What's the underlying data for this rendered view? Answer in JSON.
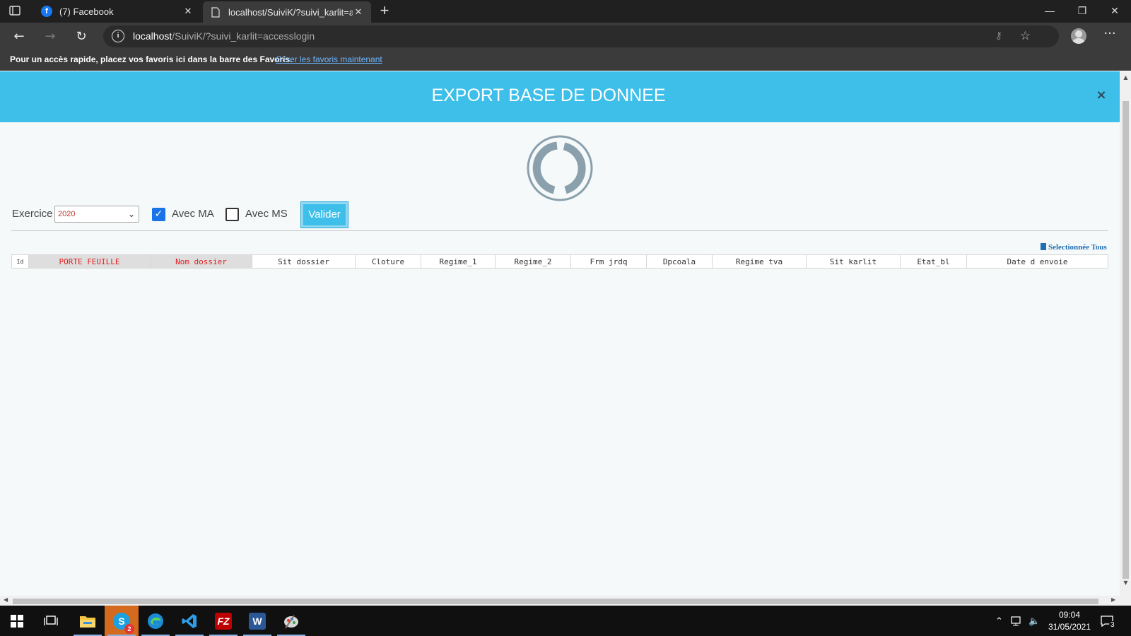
{
  "browser": {
    "tabs": [
      {
        "title": "(7) Facebook",
        "favicon": "facebook-icon",
        "active": false
      },
      {
        "title": "localhost/SuiviK/?suivi_karlit=acc",
        "favicon": "page-icon",
        "active": true
      }
    ],
    "url_host": "localhost",
    "url_rest": "/SuiviK/?suivi_karlit=accesslogin",
    "favorites_message": "Pour un accès rapide, placez vos favoris ici dans la barre des Favoris.",
    "favorites_link": "Gérer les favoris maintenant"
  },
  "modal": {
    "title": "EXPORT BASE DE DONNEE",
    "close_label": "×"
  },
  "form": {
    "exercice_label": "Exercice",
    "exercice_value": "2020",
    "avec_ma_label": "Avec MA",
    "avec_ma_checked": true,
    "avec_ms_label": "Avec MS",
    "avec_ms_checked": false,
    "valider_label": "Valider"
  },
  "table": {
    "select_all_label": "Selectionnée Tous",
    "columns": [
      {
        "label": "Id",
        "highlight": false
      },
      {
        "label": "PORTE FEUILLE",
        "highlight": true
      },
      {
        "label": "Nom dossier",
        "highlight": true
      },
      {
        "label": "Sit dossier",
        "highlight": false
      },
      {
        "label": "Cloture",
        "highlight": false
      },
      {
        "label": "Regime_1",
        "highlight": false
      },
      {
        "label": "Regime_2",
        "highlight": false
      },
      {
        "label": "Frm jrdq",
        "highlight": false
      },
      {
        "label": "Dpcoala",
        "highlight": false
      },
      {
        "label": "Regime tva",
        "highlight": false
      },
      {
        "label": "Sit karlit",
        "highlight": false
      },
      {
        "label": "Etat_bl",
        "highlight": false
      },
      {
        "label": "Date d envoie",
        "highlight": false
      }
    ],
    "rows": []
  },
  "taskbar": {
    "apps": [
      "start-icon",
      "task-view-icon",
      "file-explorer-icon",
      "skype-icon",
      "edge-icon",
      "vscode-icon",
      "filezilla-icon",
      "word-icon",
      "paint-icon"
    ],
    "skype_badge": "2",
    "time": "09:04",
    "date": "31/05/2021",
    "notification_count": "3"
  },
  "colors": {
    "header": "#3dbfea",
    "highlight_text": "#e02020",
    "checkbox": "#1a73e8"
  }
}
